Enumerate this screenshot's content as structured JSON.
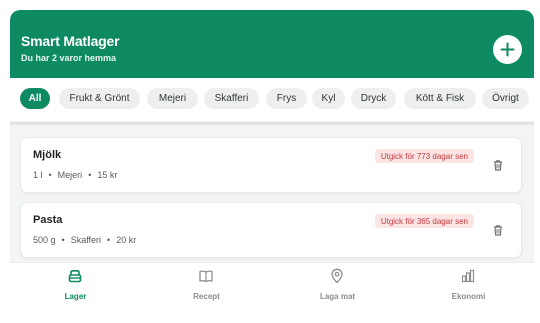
{
  "header": {
    "title": "Smart Matlager",
    "subtitle": "Du har 2 varor hemma",
    "add_icon": "plus-icon"
  },
  "colors": {
    "brand": "#0e8a62",
    "expired_bg": "#fde4e4",
    "expired_text": "#c2393d"
  },
  "filters": [
    {
      "label": "All",
      "active": true
    },
    {
      "label": "Frukt & Grönt",
      "active": false
    },
    {
      "label": "Mejeri",
      "active": false
    },
    {
      "label": "Skafferi",
      "active": false
    },
    {
      "label": "Frys",
      "active": false
    },
    {
      "label": "Kyl",
      "active": false
    },
    {
      "label": "Dryck",
      "active": false
    },
    {
      "label": "Kött & Fisk",
      "active": false
    },
    {
      "label": "Övrigt",
      "active": false
    }
  ],
  "items": [
    {
      "name": "Mjölk",
      "quantity": "1 l",
      "category": "Mejeri",
      "price": "15 kr",
      "status": "Utgick för 773 dagar sen",
      "action_icon": "trash-icon"
    },
    {
      "name": "Pasta",
      "quantity": "500 g",
      "category": "Skafferi",
      "price": "20 kr",
      "status": "Utgick för 365 dagar sen",
      "action_icon": "trash-icon"
    }
  ],
  "separator": "•",
  "nav": [
    {
      "label": "Lager",
      "icon": "storage-box-icon",
      "active": true
    },
    {
      "label": "Recept",
      "icon": "book-icon",
      "active": false
    },
    {
      "label": "Laga mat",
      "icon": "map-pin-icon",
      "active": false
    },
    {
      "label": "Ekonomi",
      "icon": "bar-chart-icon",
      "active": false
    }
  ]
}
